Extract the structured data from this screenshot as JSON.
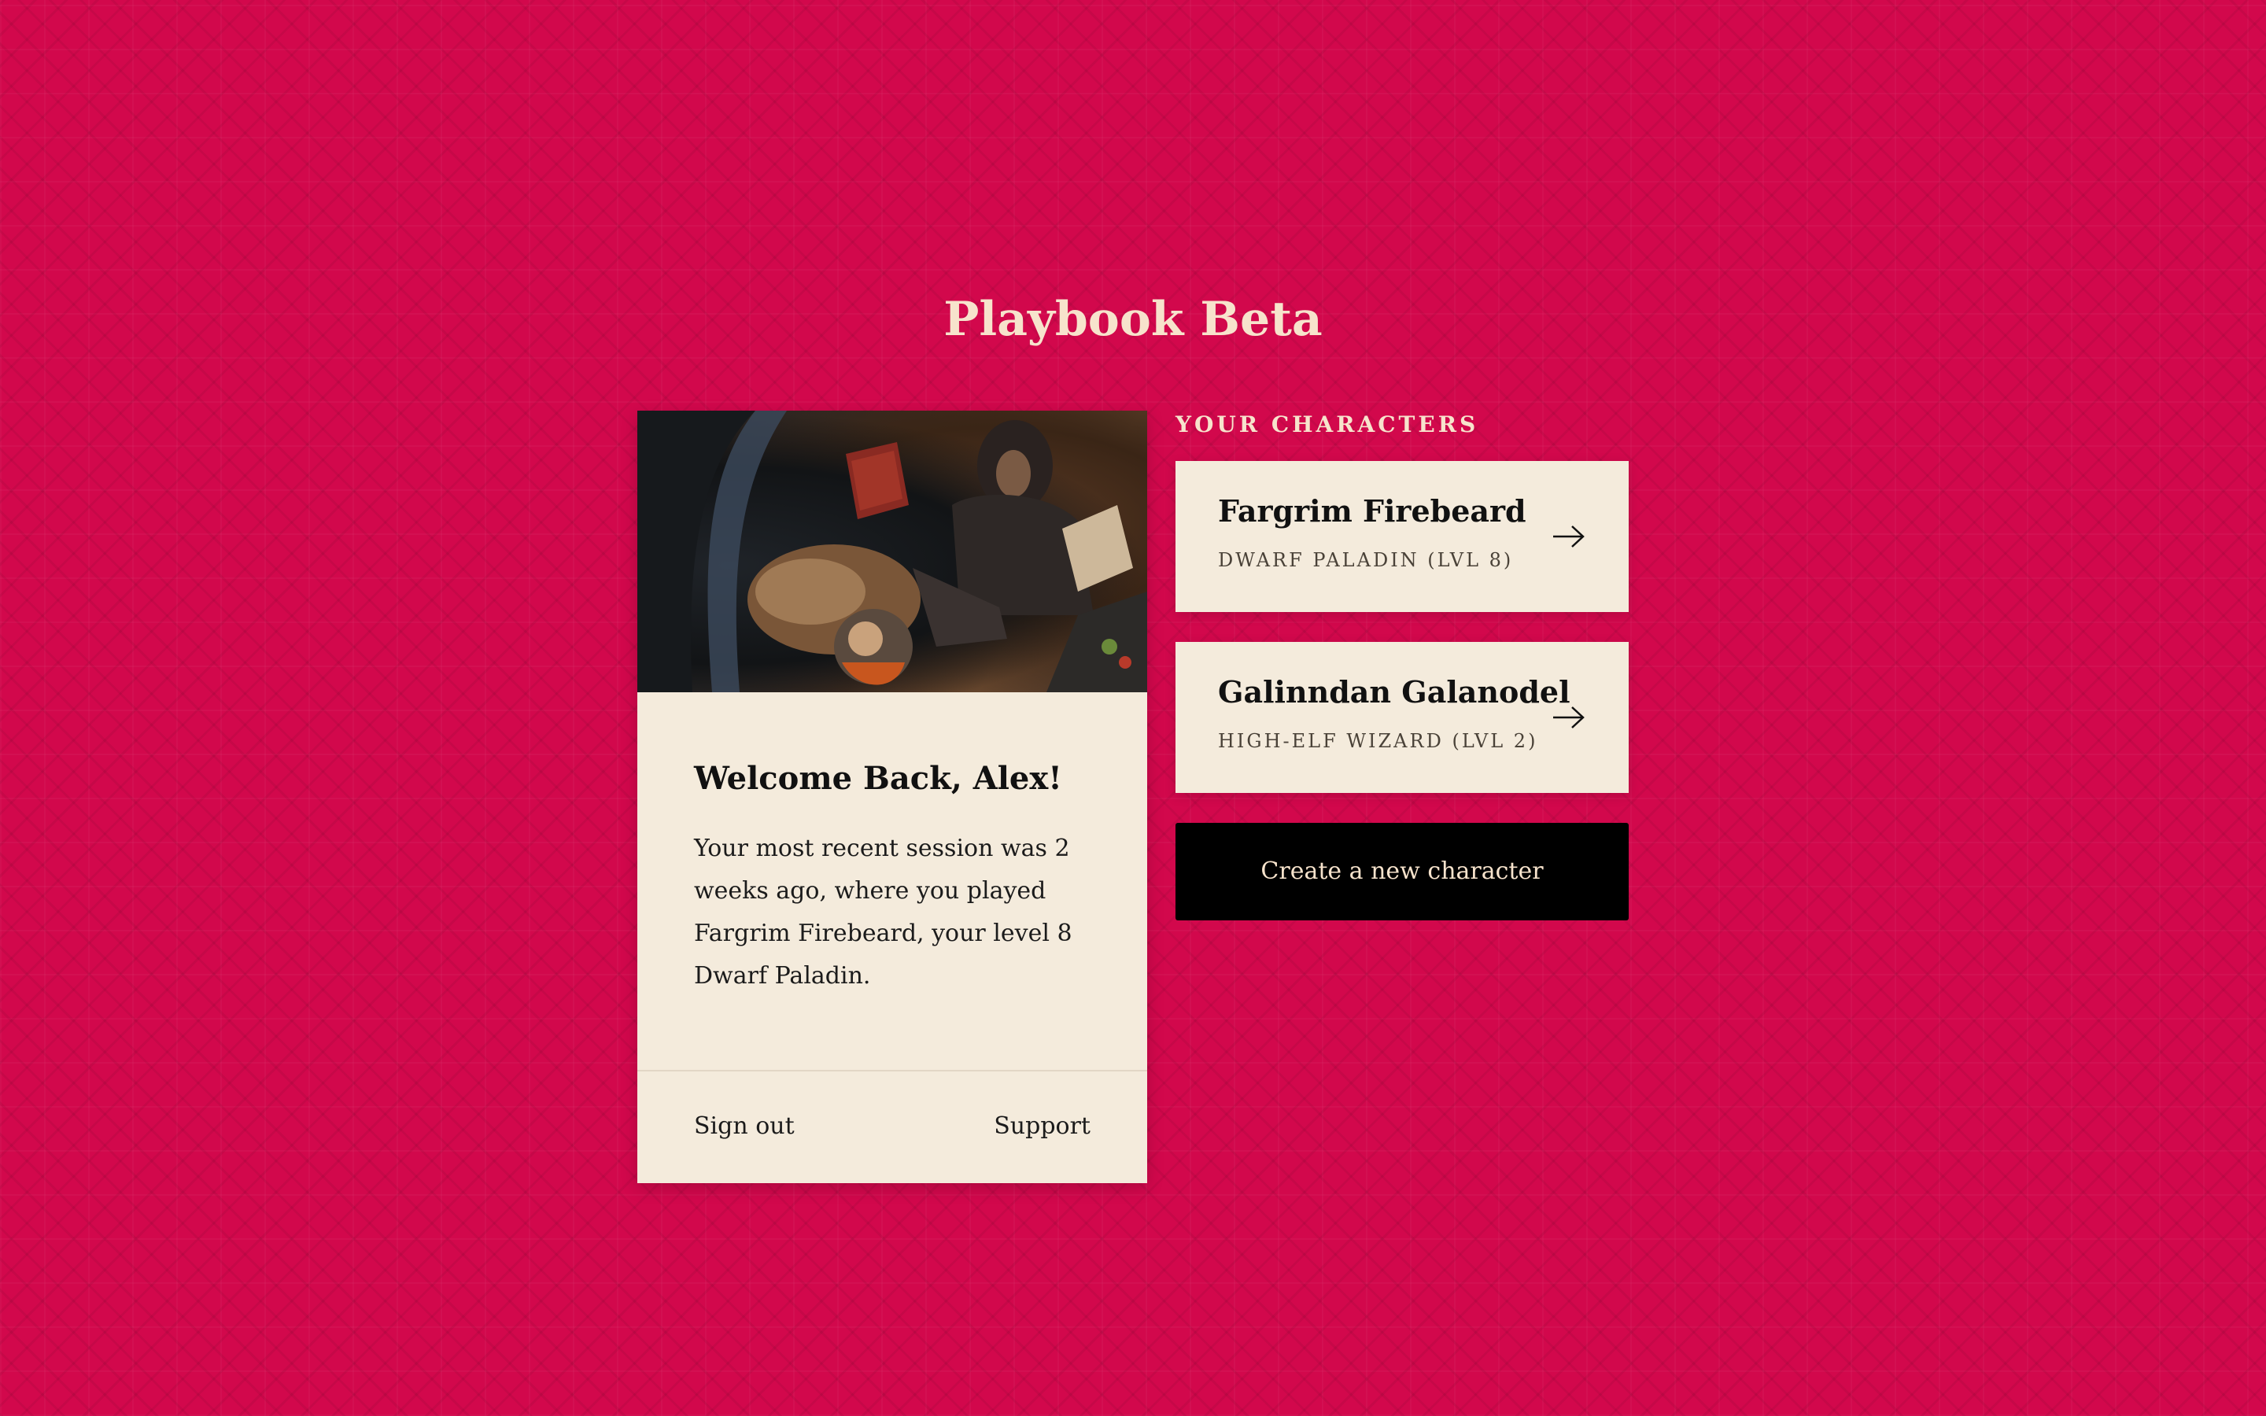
{
  "app": {
    "title": "Playbook Beta"
  },
  "welcome": {
    "heading": "Welcome Back, Alex!",
    "message": "Your most recent session was 2 weeks ago, where you played Fargrim Firebeard, your level 8 Dwarf Paladin.",
    "image": "fantasy-character-artwork"
  },
  "footer": {
    "sign_out": "Sign out",
    "support": "Support"
  },
  "characters": {
    "section_label": "YOUR CHARACTERS",
    "items": [
      {
        "name": "Fargrim Firebeard",
        "description": "DWARF PALADIN (LVL 8)",
        "icon": "arrow-right-icon"
      },
      {
        "name": "Galinndan Galanodel",
        "description": "HIGH-ELF WIZARD (LVL 2)",
        "icon": "arrow-right-icon"
      }
    ],
    "create_label": "Create a new character"
  },
  "colors": {
    "background": "#d2084c",
    "card": "#f4ebdc",
    "title_text": "#f7e3cc",
    "button": "#000000"
  }
}
